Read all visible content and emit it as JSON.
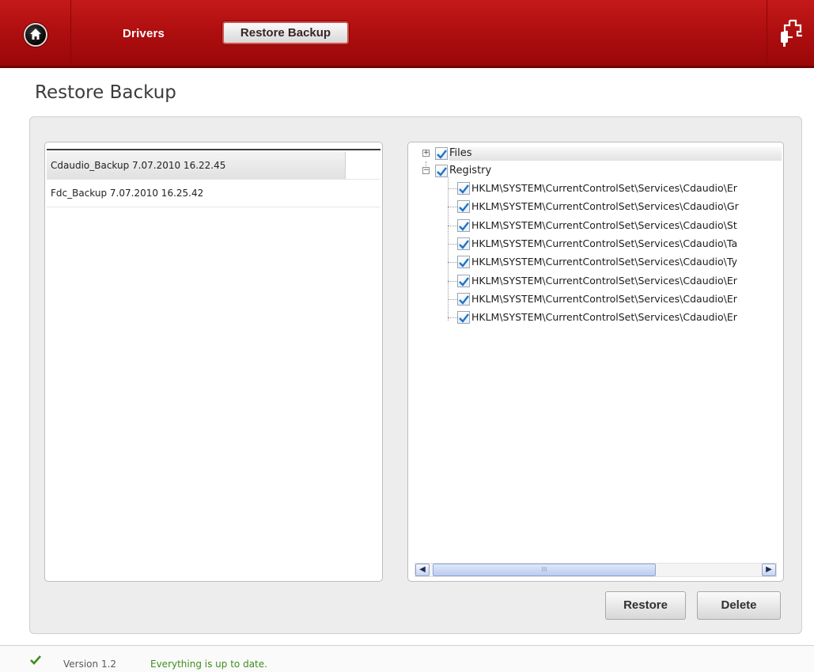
{
  "nav": {
    "drivers_label": "Drivers",
    "active_tab_label": "Restore Backup"
  },
  "page": {
    "title": "Restore Backup"
  },
  "backups": [
    "Cdaudio_Backup 7.07.2010 16.22.45",
    "Fdc_Backup 7.07.2010 16.25.42"
  ],
  "tree": {
    "files_label": "Files",
    "registry_label": "Registry",
    "registry_items": [
      "HKLM\\SYSTEM\\CurrentControlSet\\Services\\Cdaudio\\Er",
      "HKLM\\SYSTEM\\CurrentControlSet\\Services\\Cdaudio\\Gr",
      "HKLM\\SYSTEM\\CurrentControlSet\\Services\\Cdaudio\\St",
      "HKLM\\SYSTEM\\CurrentControlSet\\Services\\Cdaudio\\Ta",
      "HKLM\\SYSTEM\\CurrentControlSet\\Services\\Cdaudio\\Ty",
      "HKLM\\SYSTEM\\CurrentControlSet\\Services\\Cdaudio\\Er",
      "HKLM\\SYSTEM\\CurrentControlSet\\Services\\Cdaudio\\Er",
      "HKLM\\SYSTEM\\CurrentControlSet\\Services\\Cdaudio\\Er"
    ],
    "scroll_grip": "III"
  },
  "actions": {
    "restore_label": "Restore",
    "delete_label": "Delete"
  },
  "status": {
    "version": "Version 1.2",
    "message": "Everything is up to date."
  },
  "colors": {
    "brand_red": "#b00f10",
    "status_green": "#3e8e1c",
    "check_blue": "#1e74c8"
  },
  "icons": {
    "home": "home-icon",
    "plug": "plug-icon",
    "status": "checkmark-icon"
  }
}
